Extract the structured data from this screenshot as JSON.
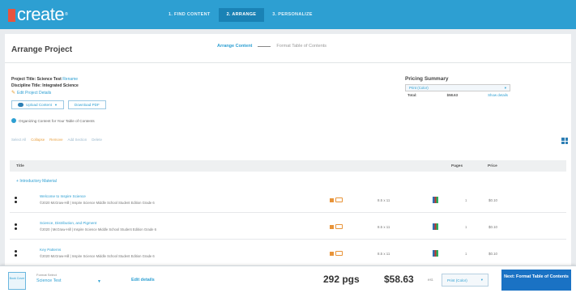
{
  "app": {
    "logo_text": "create"
  },
  "steps": [
    {
      "label": "1. FIND CONTENT"
    },
    {
      "label": "2. ARRANGE"
    },
    {
      "label": "3. PERSONALIZE"
    }
  ],
  "page": {
    "title": "Arrange Project"
  },
  "sub_tabs": {
    "active": "Arrange Content",
    "inactive": "Format Table of Contents"
  },
  "project": {
    "title_label": "Project Title:",
    "title_value": "Science Test",
    "title_link": "Rename",
    "discipline_label": "Discipline Title:",
    "discipline_value": "Integrated Science",
    "edit_link": "Edit Project Details"
  },
  "buttons": {
    "upload": "Upload Content",
    "download": "Download PDF"
  },
  "toggle_text": "Organizing Content for Your Table of Contents",
  "pricing": {
    "title": "Pricing Summary",
    "select_value": "Print (Color)",
    "total_label": "Total:",
    "total_value": "$58.63",
    "more_link": "Show details"
  },
  "toolbar": {
    "select": "Select All",
    "collapse": "Collapse",
    "remove": "Remove",
    "add_section": "Add Section",
    "delete": "Delete"
  },
  "table": {
    "col_title": "Title",
    "col_pages": "Pages",
    "col_price": "Price"
  },
  "section": {
    "label": "Introductory Material"
  },
  "rows": [
    {
      "title": "Welcome to Inspire Science",
      "source": "©2020 McGraw-Hill | Inspire Science Middle School Student Edition Grade 6",
      "size": "8.5 x 11",
      "pages": "1",
      "price": "$0.10"
    },
    {
      "title": "Science, Distribution, and Pigment",
      "source": "©2020 | McGraw-Hill | Inspire Science Middle School Student Edition Grade 6",
      "size": "8.5 x 11",
      "pages": "1",
      "price": "$0.10"
    },
    {
      "title": "Key Patterns",
      "source": "©2020 McGraw-Hill | Inspire Science Middle School Student Edition Grade 6",
      "size": "8.5 x 11",
      "pages": "1",
      "price": "$0.10"
    }
  ],
  "bottombar": {
    "thumb": "Book Cover",
    "format_label": "Format Select",
    "format_value": "Science Test",
    "edit_link": "Edit details",
    "pages": "292 pgs",
    "price": "$58.63",
    "est": "est.",
    "print_select": "Print (Color)",
    "next_button": "Next: Format Table of Contents"
  }
}
